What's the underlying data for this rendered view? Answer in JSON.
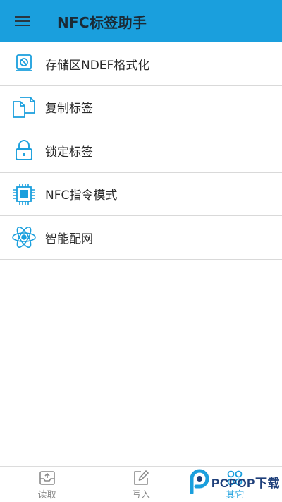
{
  "appbar": {
    "title": "NFC标签助手",
    "menu_icon": "hamburger-menu-icon",
    "background_color": "#1a9fdd"
  },
  "menu": {
    "items": [
      {
        "label": "存储区NDEF格式化",
        "icon": "storage-format-icon"
      },
      {
        "label": "复制标签",
        "icon": "copy-icon"
      },
      {
        "label": "锁定标签",
        "icon": "lock-icon"
      },
      {
        "label": "NFC指令模式",
        "icon": "chip-icon"
      },
      {
        "label": "智能配网",
        "icon": "atom-network-icon"
      }
    ],
    "icon_color": "#1a9fdd"
  },
  "bottom_nav": {
    "items": [
      {
        "label": "读取",
        "icon": "read-tray-icon",
        "active": false
      },
      {
        "label": "写入",
        "icon": "write-edit-icon",
        "active": false
      },
      {
        "label": "其它",
        "icon": "grid-apps-icon",
        "active": true
      }
    ],
    "active_color": "#1a9fdd",
    "inactive_color": "#8a8a8a"
  },
  "watermark": {
    "text": "PCPOP下载",
    "logo_icon": "pcpop-logo-icon"
  }
}
